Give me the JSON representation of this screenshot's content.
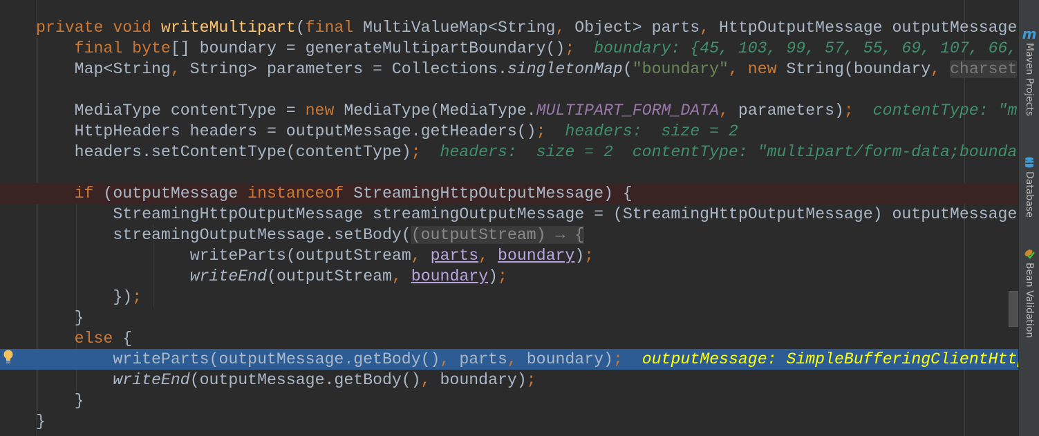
{
  "editor": {
    "lines": [
      {
        "indent": 0,
        "tokens": [
          [
            "k",
            "private void "
          ],
          [
            "m",
            "writeMultipart"
          ],
          [
            "t",
            "("
          ],
          [
            "k",
            "final "
          ],
          [
            "t",
            "MultiValueMap<String"
          ],
          [
            "k",
            ", "
          ],
          [
            "t",
            "Object> parts"
          ],
          [
            "k",
            ", "
          ],
          [
            "t",
            "HttpOutputMessage outputMessage"
          ]
        ]
      },
      {
        "indent": 4,
        "tokens": [
          [
            "k",
            "final byte"
          ],
          [
            "t",
            "[] boundary = generateMultipartBoundary()"
          ],
          [
            "k",
            ";"
          ],
          [
            "d",
            "  boundary: {45, 103, 99, 57, 55, 69, 107, 66,"
          ]
        ]
      },
      {
        "indent": 4,
        "tokens": [
          [
            "t",
            "Map<String"
          ],
          [
            "k",
            ", "
          ],
          [
            "t",
            "String> parameters = Collections."
          ],
          [
            "i",
            "singletonMap"
          ],
          [
            "t",
            "("
          ],
          [
            "s",
            "\"boundary\""
          ],
          [
            "k",
            ", new "
          ],
          [
            "t",
            "String(boundary"
          ],
          [
            "k",
            ", "
          ],
          [
            "h",
            "charset"
          ]
        ]
      },
      {
        "indent": 4,
        "tokens": []
      },
      {
        "indent": 4,
        "tokens": [
          [
            "t",
            "MediaType contentType = "
          ],
          [
            "k",
            "new "
          ],
          [
            "t",
            "MediaType(MediaType."
          ],
          [
            "c",
            "MULTIPART_FORM_DATA"
          ],
          [
            "k",
            ", "
          ],
          [
            "t",
            "parameters)"
          ],
          [
            "k",
            ";"
          ],
          [
            "d",
            "  contentType: \"m"
          ]
        ]
      },
      {
        "indent": 4,
        "tokens": [
          [
            "t",
            "HttpHeaders headers = outputMessage.getHeaders()"
          ],
          [
            "k",
            ";"
          ],
          [
            "d",
            "  headers:  size = 2"
          ]
        ]
      },
      {
        "indent": 4,
        "tokens": [
          [
            "t",
            "headers.setContentType(contentType)"
          ],
          [
            "k",
            ";"
          ],
          [
            "d",
            "  headers:  size = 2  contentType: \"multipart/form-data;bounda"
          ]
        ]
      },
      {
        "indent": 4,
        "tokens": []
      },
      {
        "indent": 4,
        "state": "breakpoint",
        "tokens": [
          [
            "k",
            "if "
          ],
          [
            "t",
            "(outputMessage "
          ],
          [
            "k",
            "instanceof "
          ],
          [
            "t",
            "StreamingHttpOutputMessage) {"
          ]
        ]
      },
      {
        "indent": 8,
        "tokens": [
          [
            "t",
            "StreamingHttpOutputMessage streamingOutputMessage = (StreamingHttpOutputMessage) outputMessage"
          ]
        ]
      },
      {
        "indent": 8,
        "tokens": [
          [
            "t",
            "streamingOutputMessage.setBody("
          ],
          [
            "p",
            "(outputStream) → {"
          ]
        ]
      },
      {
        "indent": 16,
        "tokens": [
          [
            "t",
            "writeParts(outputStream"
          ],
          [
            "k",
            ", "
          ],
          [
            "u",
            "parts"
          ],
          [
            "k",
            ", "
          ],
          [
            "u",
            "boundary"
          ],
          [
            "t",
            ")"
          ],
          [
            "k",
            ";"
          ]
        ]
      },
      {
        "indent": 16,
        "tokens": [
          [
            "i",
            "writeEnd"
          ],
          [
            "t",
            "(outputStream"
          ],
          [
            "k",
            ", "
          ],
          [
            "u",
            "boundary"
          ],
          [
            "t",
            ")"
          ],
          [
            "k",
            ";"
          ]
        ]
      },
      {
        "indent": 8,
        "tokens": [
          [
            "t",
            "})"
          ],
          [
            "k",
            ";"
          ]
        ]
      },
      {
        "indent": 4,
        "tokens": [
          [
            "t",
            "}"
          ]
        ]
      },
      {
        "indent": 4,
        "tokens": [
          [
            "k",
            "else "
          ],
          [
            "t",
            "{"
          ]
        ]
      },
      {
        "indent": 8,
        "state": "execution",
        "tokens": [
          [
            "t",
            "writeParts(outputMessage.getBody()"
          ],
          [
            "k",
            ", "
          ],
          [
            "t",
            "parts"
          ],
          [
            "k",
            ", "
          ],
          [
            "t",
            "boundary)"
          ],
          [
            "k",
            ";"
          ],
          [
            "y",
            "  outputMessage: SimpleBufferingClientHttpRequest"
          ]
        ]
      },
      {
        "indent": 8,
        "tokens": [
          [
            "i",
            "writeEnd"
          ],
          [
            "t",
            "(outputMessage.getBody()"
          ],
          [
            "k",
            ", "
          ],
          [
            "t",
            "boundary)"
          ],
          [
            "k",
            ";"
          ]
        ]
      },
      {
        "indent": 4,
        "tokens": [
          [
            "t",
            "}"
          ]
        ]
      },
      {
        "indent": 0,
        "tokens": [
          [
            "t",
            "}"
          ]
        ]
      }
    ]
  },
  "toolwindows": {
    "maven": {
      "label": "Maven Projects",
      "icon": "maven-icon"
    },
    "database": {
      "label": "Database",
      "icon": "database-icon"
    },
    "bean": {
      "label": "Bean Validation",
      "icon": "bean-validation-icon"
    }
  },
  "colors": {
    "keyword": "#cc7832",
    "text": "#a9b7c6",
    "execution_line": "#2d5c94",
    "breakpoint_line": "#3a2323",
    "debug_value": "#3f8f6a"
  }
}
